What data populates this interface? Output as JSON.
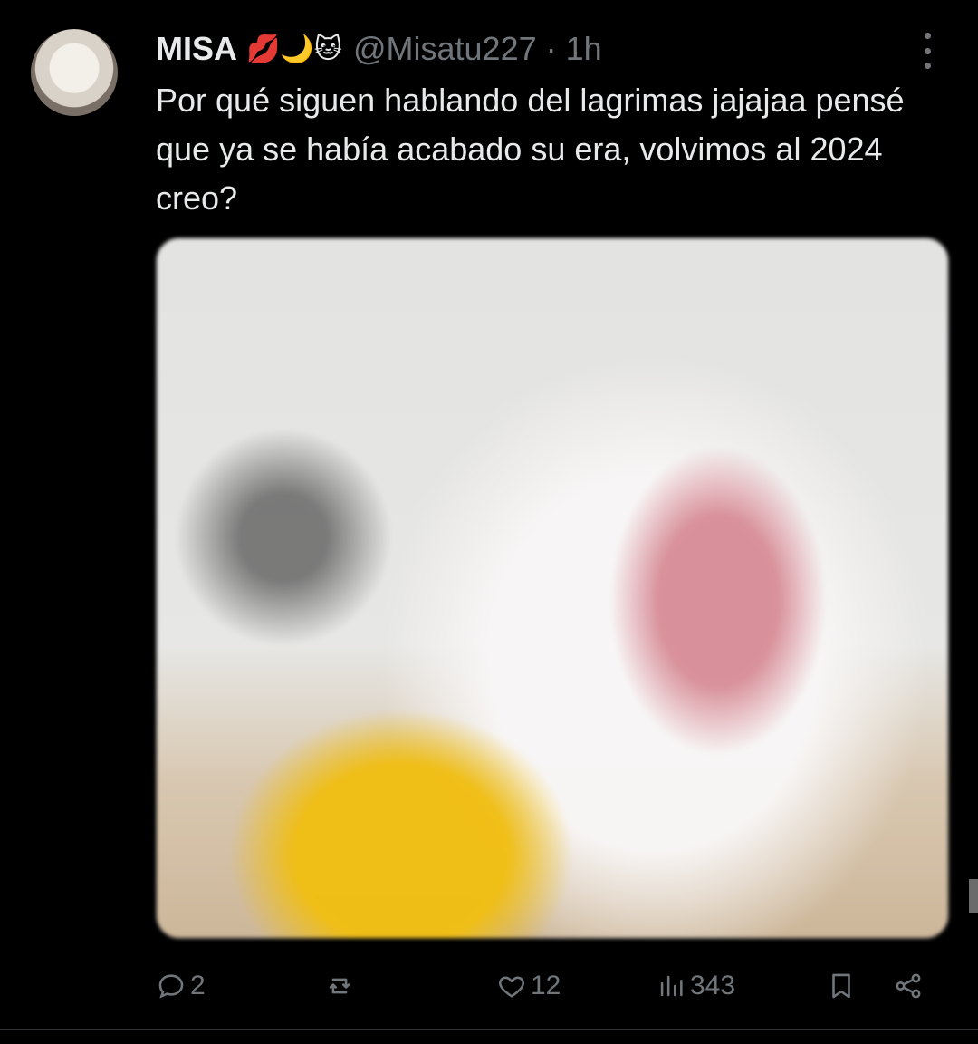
{
  "tweet": {
    "author_name": "MISA",
    "author_emojis": "💋🌙🐱",
    "handle": "@Misatu227",
    "separator": "·",
    "time": "1h",
    "text": "Por qué siguen hablando del lagrimas jajajaa pensé que ya se había acabado su era, volvimos al 2024 creo?"
  },
  "actions": {
    "replies": "2",
    "reposts": "",
    "likes": "12",
    "views": "343"
  },
  "icons": {
    "more": "more-icon",
    "reply": "reply-icon",
    "repost": "repost-icon",
    "like": "like-icon",
    "views": "views-icon",
    "bookmark": "bookmark-icon",
    "share": "share-icon"
  },
  "colors": {
    "background": "#000000",
    "text": "#e7e9ea",
    "muted": "#71767b",
    "divider": "#2f3336"
  }
}
